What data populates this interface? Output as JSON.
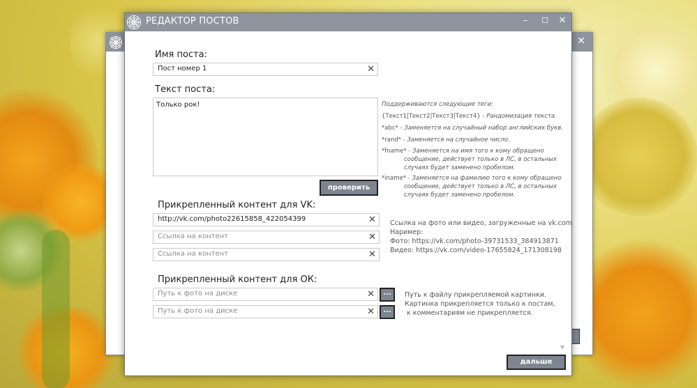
{
  "window": {
    "title": "РЕДАКТОР ПОСТОВ",
    "minimize_glyph": "–",
    "maximize_glyph": "☐",
    "close_glyph": "✕",
    "logo_icon": "spiderweb-icon"
  },
  "post_name": {
    "label": "Имя поста:",
    "value": "Пост номер 1"
  },
  "post_text": {
    "label": "Текст поста:",
    "value": "Только рок!",
    "check_button": "проверить"
  },
  "tags_help": {
    "heading": "Поддерживаются следующие теги:",
    "items": [
      {
        "code": "{Текст1|Текст2|Текст3|Текст4}",
        "desc": " - Рандомизация текста."
      },
      {
        "code": "*abc*",
        "desc": " - Заменяется на случайный набор английских букв."
      },
      {
        "code": "*rand*",
        "desc": " - Заменяется на случайное число."
      },
      {
        "code": "*fname*",
        "desc": " - Заменяется на имя того к кому обращено",
        "cont": [
          "сообщение, действует только в ЛС, в остальных",
          "случаях будет заменено пробелом."
        ]
      },
      {
        "code": "*iname*",
        "desc": " - Заменяется на фамилию того к кому обращено",
        "cont": [
          "сообщение, действует только в ЛС, в остальных",
          "случаях будет заменено пробелом."
        ]
      }
    ]
  },
  "vk": {
    "label": "Прикрепленный контент для VK:",
    "fields": [
      {
        "value": "http://vk.com/photo22615858_422054399",
        "placeholder": ""
      },
      {
        "value": "",
        "placeholder": "Ссылка на контент"
      },
      {
        "value": "",
        "placeholder": "Ссылка на контент"
      }
    ],
    "info": [
      "Ссылка на фото или видео, загруженные на vk.com",
      "Наример:",
      "Фото: https://vk.com/photo-39731533_384913871",
      "Видео: https://vk.com/video-17655824_171308198"
    ]
  },
  "ok": {
    "label": "Прикрепленный контент для ОК:",
    "fields": [
      {
        "value": "",
        "placeholder": "Путь к фото на диске",
        "browse": "..."
      },
      {
        "value": "",
        "placeholder": "Путь к фото на диске",
        "browse": "..."
      }
    ],
    "info": [
      "Путь к файлу прикрепляемой картинки.",
      "Картинка прикрепляется только к постам,",
      " к комментариям не прикрепляется."
    ]
  },
  "clear_glyph": "✕",
  "next_button": "дальше",
  "colors": {
    "titlebar": "#8d949d",
    "button": "#7d8591"
  }
}
